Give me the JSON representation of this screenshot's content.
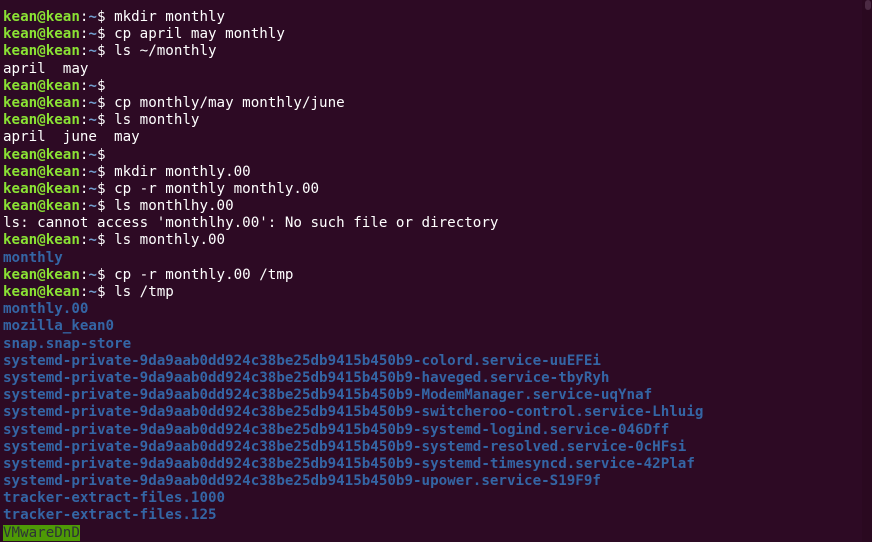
{
  "prompt": {
    "user_host": "kean@kean",
    "colon": ":",
    "path": "~",
    "symbol": "$ "
  },
  "lines": [
    {
      "type": "prompt",
      "command": "mkdir monthly"
    },
    {
      "type": "prompt",
      "command": "cp april may monthly"
    },
    {
      "type": "prompt",
      "command": "ls ~/monthly"
    },
    {
      "type": "output",
      "text": "april  may"
    },
    {
      "type": "prompt",
      "command": ""
    },
    {
      "type": "prompt",
      "command": "cp monthly/may monthly/june"
    },
    {
      "type": "prompt",
      "command": "ls monthly"
    },
    {
      "type": "output",
      "text": "april  june  may"
    },
    {
      "type": "prompt",
      "command": ""
    },
    {
      "type": "prompt",
      "command": "mkdir monthly.00"
    },
    {
      "type": "prompt",
      "command": "cp -r monthly monthly.00"
    },
    {
      "type": "prompt",
      "command": "ls monthlhy.00"
    },
    {
      "type": "output",
      "text": "ls: cannot access 'monthlhy.00': No such file or directory"
    },
    {
      "type": "prompt",
      "command": "ls monthly.00"
    },
    {
      "type": "dir",
      "text": "monthly"
    },
    {
      "type": "prompt",
      "command": "cp -r monthly.00 /tmp"
    },
    {
      "type": "prompt",
      "command": "ls /tmp"
    },
    {
      "type": "dir",
      "text": "monthly.00"
    },
    {
      "type": "dir",
      "text": "mozilla_kean0"
    },
    {
      "type": "dir",
      "text": "snap.snap-store"
    },
    {
      "type": "dir",
      "text": "systemd-private-9da9aab0dd924c38be25db9415b450b9-colord.service-uuEFEi"
    },
    {
      "type": "dir",
      "text": "systemd-private-9da9aab0dd924c38be25db9415b450b9-haveged.service-tbyRyh"
    },
    {
      "type": "dir",
      "text": "systemd-private-9da9aab0dd924c38be25db9415b450b9-ModemManager.service-uqYnaf"
    },
    {
      "type": "dir",
      "text": "systemd-private-9da9aab0dd924c38be25db9415b450b9-switcheroo-control.service-Lhluig"
    },
    {
      "type": "dir",
      "text": "systemd-private-9da9aab0dd924c38be25db9415b450b9-systemd-logind.service-046Dff"
    },
    {
      "type": "dir",
      "text": "systemd-private-9da9aab0dd924c38be25db9415b450b9-systemd-resolved.service-0cHFsi"
    },
    {
      "type": "dir",
      "text": "systemd-private-9da9aab0dd924c38be25db9415b450b9-systemd-timesyncd.service-42Plaf"
    },
    {
      "type": "dir",
      "text": "systemd-private-9da9aab0dd924c38be25db9415b450b9-upower.service-S19F9f"
    },
    {
      "type": "dir",
      "text": "tracker-extract-files.1000"
    },
    {
      "type": "dir",
      "text": "tracker-extract-files.125"
    },
    {
      "type": "sticky",
      "text": "VMwareDnD"
    }
  ],
  "colors": {
    "background": "#2d0a24",
    "user_host": "#8ae234",
    "path": "#729fcf",
    "directory": "#3465a4",
    "sticky_bg": "#4e9a06"
  }
}
